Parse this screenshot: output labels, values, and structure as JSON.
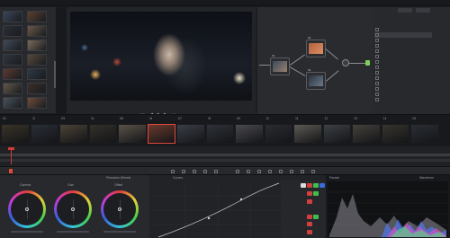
{
  "topbar": {
    "left_menu": "",
    "center_label": "",
    "clip_label": "",
    "right_label": ""
  },
  "gallery": {
    "items": 14
  },
  "viewer": {
    "timecode": "01:00:00:22",
    "zoom": "",
    "transport": [
      "prev-icon",
      "play-reverse-icon",
      "stop-icon",
      "play-icon",
      "next-icon"
    ]
  },
  "nodes": [
    {
      "label": "01"
    },
    {
      "label": "02"
    },
    {
      "label": "03"
    }
  ],
  "right_panel": {
    "title": "",
    "items": [
      "",
      "",
      "",
      "",
      "",
      "",
      "",
      "",
      "",
      "",
      "",
      "",
      "",
      ""
    ],
    "keyframes_title": "",
    "keyframes_sub": ""
  },
  "timeline": {
    "clips": [
      {
        "id": "01",
        "tc": ""
      },
      {
        "id": "02",
        "tc": ""
      },
      {
        "id": "03",
        "tc": ""
      },
      {
        "id": "04",
        "tc": ""
      },
      {
        "id": "05",
        "tc": ""
      },
      {
        "id": "06",
        "tc": ""
      },
      {
        "id": "07",
        "tc": ""
      },
      {
        "id": "08",
        "tc": ""
      },
      {
        "id": "09",
        "tc": ""
      },
      {
        "id": "10",
        "tc": ""
      },
      {
        "id": "11",
        "tc": ""
      },
      {
        "id": "12",
        "tc": ""
      },
      {
        "id": "13",
        "tc": ""
      },
      {
        "id": "14",
        "tc": ""
      },
      {
        "id": "15",
        "tc": ""
      }
    ]
  },
  "color_wheels": {
    "header": "Primaries Wheels",
    "wheels": [
      "Gamma",
      "Gain",
      "Offset"
    ]
  },
  "curves": {
    "header": "Curves"
  },
  "scopes": {
    "header": "Parade",
    "right": "Waveform"
  },
  "colors": {
    "accent": "#e0483c",
    "playhead": "#d23a32",
    "panel": "#28292d",
    "background": "#1e1f22"
  }
}
